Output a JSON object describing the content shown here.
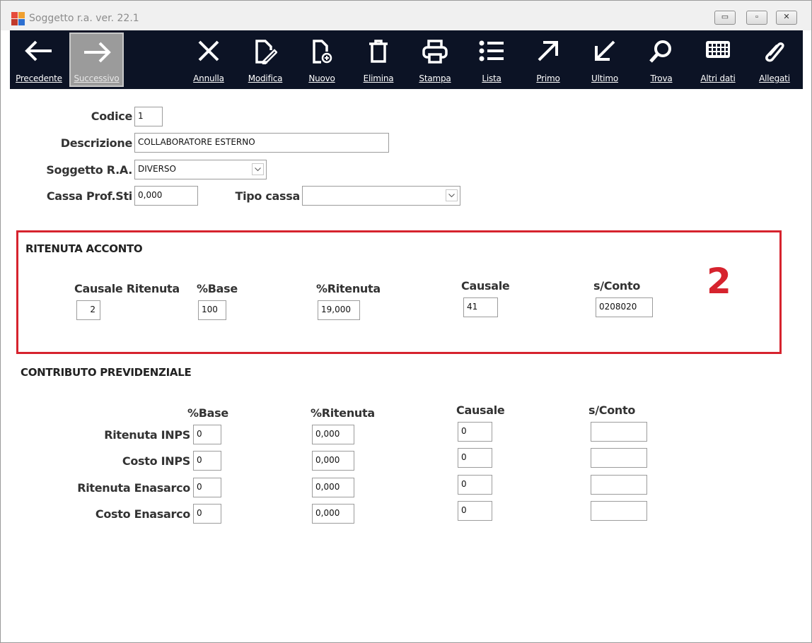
{
  "window": {
    "title": "Soggetto r.a.  ver. 22.1",
    "min_glyph": "▭",
    "max_glyph": "▫",
    "close_glyph": "✕"
  },
  "toolbar": {
    "precedente": "Precedente",
    "successivo": "Successivo",
    "annulla": "Annulla",
    "modifica": "Modifica",
    "nuovo": "Nuovo",
    "elimina": "Elimina",
    "stampa": "Stampa",
    "lista": "Lista",
    "primo": "Primo",
    "ultimo": "Ultimo",
    "trova": "Trova",
    "altri_dati": "Altri dati",
    "allegati": "Allegati"
  },
  "form": {
    "codice_label": "Codice",
    "codice_value": "1",
    "descrizione_label": "Descrizione",
    "descrizione_value": "COLLABORATORE ESTERNO",
    "soggetto_label": "Soggetto R.A.",
    "soggetto_value": "DIVERSO",
    "cassa_label": "Cassa Prof.Sti",
    "cassa_value": "0,000",
    "tipo_cassa_label": "Tipo cassa",
    "tipo_cassa_value": ""
  },
  "ritenuta": {
    "title": "RITENUTA ACCONTO",
    "causale_ritenuta_label": "Causale Ritenuta",
    "causale_ritenuta_value": "2",
    "base_label": "%Base",
    "base_value": "100",
    "ritenuta_label": "%Ritenuta",
    "ritenuta_value": "19,000",
    "causale_label": "Causale",
    "causale_value": "41",
    "sconto_label": "s/Conto",
    "sconto_value": "0208020",
    "annotation": "2"
  },
  "contributo": {
    "title": "CONTRIBUTO PREVIDENZIALE",
    "base_header": "%Base",
    "ritenuta_header": "%Ritenuta",
    "causale_header": "Causale",
    "sconto_header": "s/Conto",
    "rows": [
      {
        "label": "Ritenuta INPS",
        "base": "0",
        "ritenuta": "0,000",
        "causale": "0",
        "sconto": ""
      },
      {
        "label": "Costo INPS",
        "base": "0",
        "ritenuta": "0,000",
        "causale": "0",
        "sconto": ""
      },
      {
        "label": "Ritenuta Enasarco",
        "base": "0",
        "ritenuta": "0,000",
        "causale": "0",
        "sconto": ""
      },
      {
        "label": "Costo Enasarco",
        "base": "0",
        "ritenuta": "0,000",
        "causale": "0",
        "sconto": ""
      }
    ]
  },
  "colors": {
    "toolbar_bg": "#0c1325",
    "annotation_red": "#d6232e"
  }
}
